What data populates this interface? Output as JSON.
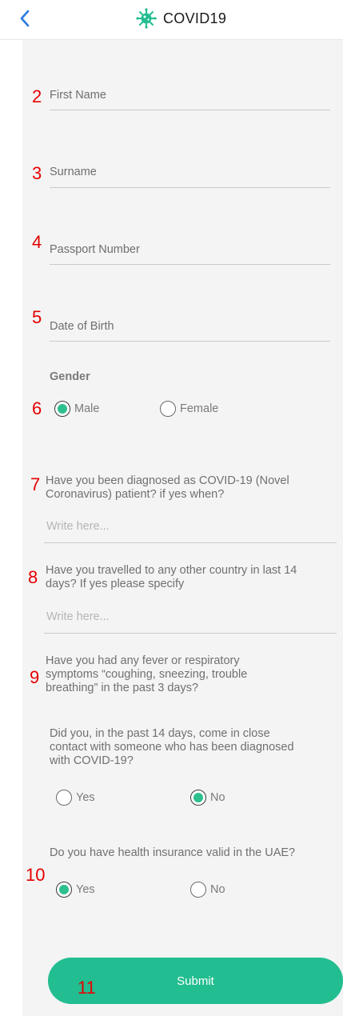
{
  "header": {
    "title": "COVID19",
    "back_icon": "chevron-left-icon",
    "logo_icon": "virus-icon",
    "accent_color": "#2b7be0",
    "logo_color": "#22bd90"
  },
  "annotations": {
    "n2": "2",
    "n3": "3",
    "n4": "4",
    "n5": "5",
    "n6": "6",
    "n7": "7",
    "n8": "8",
    "n9": "9",
    "n10": "10",
    "n11": "11"
  },
  "form": {
    "first_name_placeholder": "First Name",
    "surname_placeholder": "Surname",
    "passport_placeholder": "Passport Number",
    "dob_placeholder": "Date of Birth",
    "gender_label": "Gender",
    "gender_male": "Male",
    "gender_female": "Female",
    "gender_selected": "Male",
    "q_diagnosed_line1": "Have you been diagnosed as COVID-19 (Novel",
    "q_diagnosed_line2": "Coronavirus) patient? if yes when?",
    "q_diagnosed_placeholder": "Write here...",
    "q_travel_line1": "Have you travelled to any other country in last 14",
    "q_travel_line2": "days? If yes please specify",
    "q_travel_placeholder": "Write here...",
    "q_fever_line1": "Have you had any fever or respiratory",
    "q_fever_line2": "symptoms “coughing, sneezing, trouble",
    "q_fever_line3": "breathing” in the past 3 days?",
    "q_contact_line1": "Did you, in the past 14 days, come in close",
    "q_contact_line2": "contact with someone who has been diagnosed",
    "q_contact_line3": "with COVID-19?",
    "contact_yes": "Yes",
    "contact_no": "No",
    "contact_selected": "No",
    "q_insurance": "Do you have health insurance valid in the UAE?",
    "insurance_yes": "Yes",
    "insurance_no": "No",
    "insurance_selected": "Yes",
    "submit_label": "Submit",
    "radio_color": "#2dbf8f"
  }
}
